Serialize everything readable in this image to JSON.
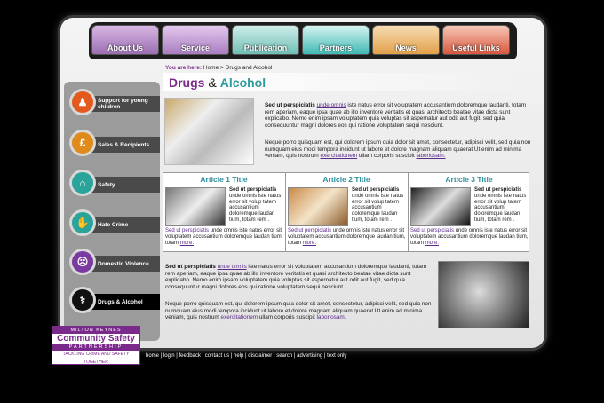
{
  "nav": {
    "tabs": [
      {
        "label": "About Us"
      },
      {
        "label": "Service"
      },
      {
        "label": "Publication"
      },
      {
        "label": "Partners"
      },
      {
        "label": "News"
      },
      {
        "label": "Useful Links"
      }
    ]
  },
  "breadcrumb": {
    "label": "You are here:",
    "home": "Home",
    "sep": ">",
    "current": "Drugs and Alcohol"
  },
  "title": {
    "part1": "Drugs",
    "amp": "&",
    "part2": "Alcohol"
  },
  "sidebar": {
    "items": [
      {
        "label": "Support for young children",
        "icon": "family-icon",
        "color": "#e25a1c",
        "glyph": "♟"
      },
      {
        "label": "Sales & Recipients",
        "icon": "pound-icon",
        "color": "#e08a1c",
        "glyph": "£"
      },
      {
        "label": "Safety",
        "icon": "safety-icon",
        "color": "#2aa39b",
        "glyph": "⌂"
      },
      {
        "label": "Hate Crime",
        "icon": "hate-crime-icon",
        "color": "#2aa39b",
        "glyph": "✋"
      },
      {
        "label": "Domestic Violence",
        "icon": "domestic-icon",
        "color": "#7a3aa0",
        "glyph": "☹"
      },
      {
        "label": "Drugs & Alcohol",
        "icon": "drugs-icon",
        "color": "#111111",
        "glyph": "⚕"
      }
    ]
  },
  "intro": {
    "p1_bold": "Sed ut perspiciatis",
    "p1_link": "unde omnis",
    "p1_text": " iste natus error sit voluptatem accusantium doloremque laudanti, totam rem aperiam, eaque ipsa quae ab illo inventore veritatis et quasi architecto beatae vitae dicta sunt explicabo. Nemo enim ipsam voluptatem quia voluptas sit aspernatur aut odit aut fugit, sed quia consequuntur magni dolores eos qui ratione voluptatem sequi nesciunt.",
    "p2_text": "Neque porro quisquam est, qui dolorem ipsum quia dolor sit amet, consectetur, adipisci velit, sed quia non numquam eius modi tempora incidunt ut labore et dolore magnam aliquam quaerat Ut enim ad minima veniam, quis nostrum ",
    "p2_link1": "exercitationem",
    "p2_mid": " ullam corporis suscipit ",
    "p2_link2": "laboriosam."
  },
  "articles": [
    {
      "title": "Article 1 Title",
      "bold": "Sed ut perspiciatis",
      "text": "unde omnis iste natus error sit volup tatem accusantium doloremque laudan tium, totam rem .",
      "foot_link": "Sed ut perspiciatis",
      "foot": " unde omnis iste natus error sit voluptatem accusantium doloremque laudan tium, totam ",
      "more": "more."
    },
    {
      "title": "Article 2 Title",
      "bold": "Sed ut perspiciatis",
      "text": "unde omnis iste natus error sit volup tatem accusantium doloremque laudan tium, totam rem .",
      "foot_link": "Sed ut perspiciatis",
      "foot": " unde omnis iste natus error sit voluptatem accusantium doloremque laudan tium, totam ",
      "more": "more."
    },
    {
      "title": "Article 3 Title",
      "bold": "Sed ut perspiciatis",
      "text": "unde omnis iste natus error sit volup tatem accusantium doloremque laudan tium, totam rem .",
      "foot_link": "Sed ut perspiciatis",
      "foot": " unde omnis iste natus error sit voluptatem accusantium doloremque laudan tium, totam ",
      "more": "more."
    }
  ],
  "lower": {
    "p1_bold": "Sed ut perspiciatis",
    "p1_link": "unde omnis",
    "p1_text": " iste natus error sit voluptatem accusantium doloremque laudanti, totam rem aperiam, eaque ipsa quae ab illo inventore veritatis et quasi architecto beatae vitae dicta sunt explicabo. Nemo enim ipsam voluptatem quia voluptas sit aspernatur aut odit aut fugit, sed quia consequuntur magni dolores eos qui ratione voluptatem sequi nesciunt.",
    "p2_text": "Neque porro quisquam est, qui dolorem ipsum quia dolor sit amet, consectetur, adipisci velit, sed quia non numquam eius modi tempora incidunt ut labore et dolore magnam aliquam quaerat Ut enim ad minima veniam, quis nostrum ",
    "p2_link1": "exercitationem",
    "p2_mid": " ullam corporis suscipit ",
    "p2_link2": "laboriosam."
  },
  "logo": {
    "line1": "MILTON KEYNES",
    "line2": "Community Safety",
    "line3": "PARTNERSHIP",
    "line4": "TACKLING CRIME AND SAFETY TOGETHER"
  },
  "footer": {
    "links": [
      "home",
      "login",
      "feedback",
      "contact us",
      "help",
      "disclaimer",
      "search",
      "advertising",
      "text only"
    ],
    "sep": " | "
  }
}
